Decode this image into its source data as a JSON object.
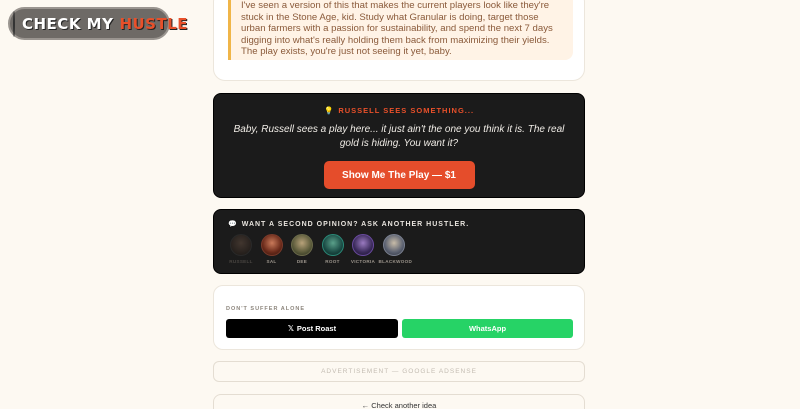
{
  "brand": {
    "word1": "CHECK MY",
    "word2": "HUSTLE",
    "accent_color": "#e8502a"
  },
  "quote": {
    "text": "I've seen a version of this that makes the current players look like they're stuck in the Stone Age, kid. Study what Granular is doing, target those urban farmers with a passion for sustainability, and spend the next 7 days digging into what's really holding them back from maximizing their yields. The play exists, you're just not seeing it yet, baby."
  },
  "russell": {
    "icon": "lightbulb-icon",
    "title": "RUSSELL SEES SOMETHING...",
    "body": "Baby, Russell sees a play here... it just ain't the one you think it is. The real gold is hiding. You want it?",
    "button_label": "Show Me The Play — $1",
    "button_color": "#e54d2b"
  },
  "opinion": {
    "icon": "speech-bubble-icon",
    "title": "WANT A SECOND OPINION? ASK ANOTHER HUSTLER.",
    "hustlers": [
      {
        "name": "RUSSELL",
        "active": false
      },
      {
        "name": "SAL",
        "active": true
      },
      {
        "name": "DEE",
        "active": true
      },
      {
        "name": "ROOT",
        "active": true
      },
      {
        "name": "VICTORIA",
        "active": true
      },
      {
        "name": "BLACKWOOD",
        "active": true
      }
    ]
  },
  "share": {
    "label": "DON'T SUFFER ALONE",
    "x_button": "Post Roast",
    "whatsapp_button": "WhatsApp",
    "whatsapp_color": "#26d366"
  },
  "ad": {
    "label": "ADVERTISEMENT — GOOGLE ADSENSE"
  },
  "footer": {
    "check_another": "← Check another idea"
  }
}
